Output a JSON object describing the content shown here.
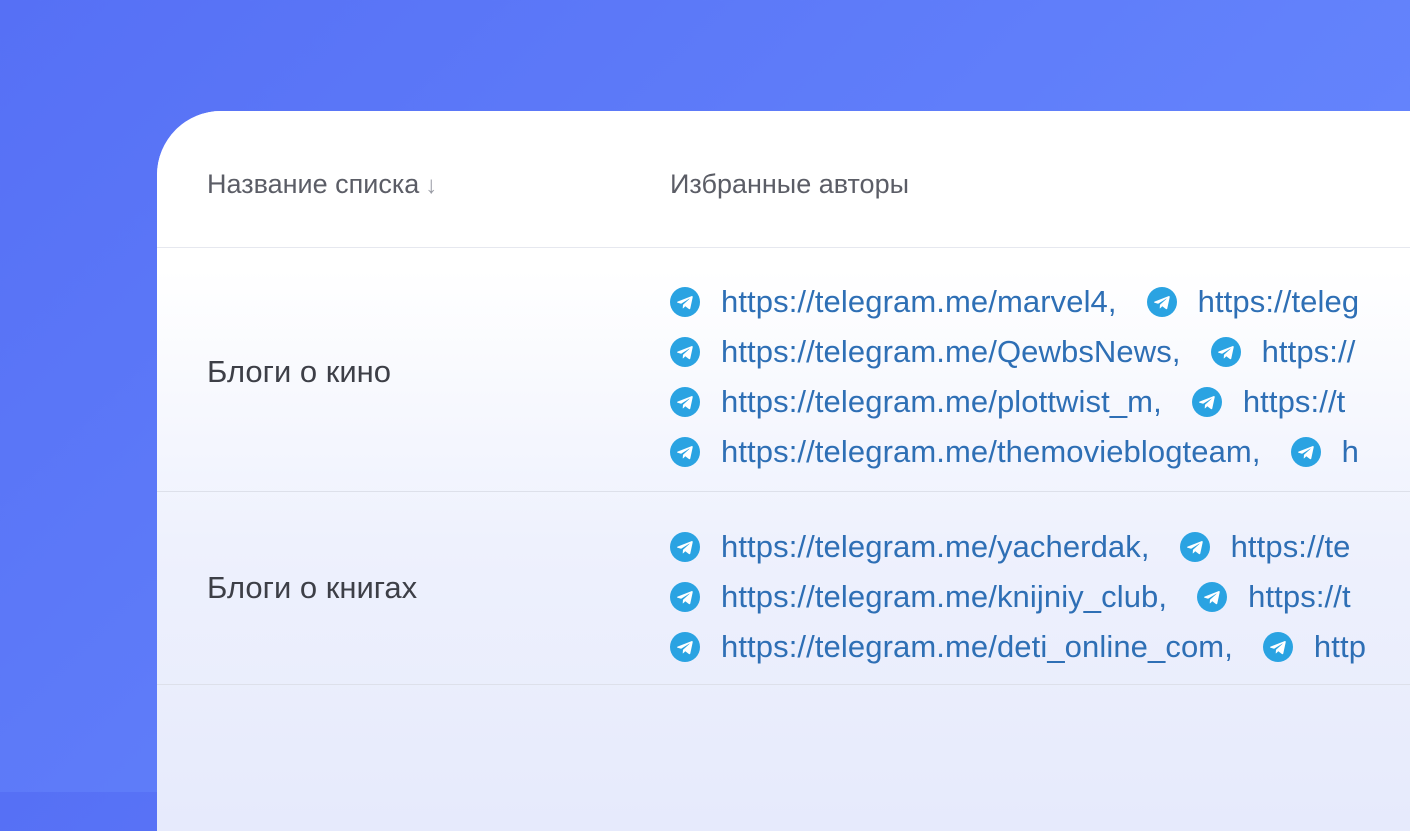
{
  "table": {
    "columns": [
      {
        "label": "Название списка",
        "sort_icon": "↓"
      },
      {
        "label": "Избранные авторы"
      }
    ],
    "rows": [
      {
        "name": "Блоги о кино",
        "links": [
          [
            "https://telegram.me/marvel4,",
            "https://teleg"
          ],
          [
            "https://telegram.me/QewbsNews,",
            "https://"
          ],
          [
            "https://telegram.me/plottwist_m,",
            "https://t"
          ],
          [
            "https://telegram.me/themovieblogteam,",
            "h"
          ]
        ]
      },
      {
        "name": "Блоги о книгах",
        "links": [
          [
            "https://telegram.me/yacherdak,",
            "https://te"
          ],
          [
            "https://telegram.me/knijniy_club,",
            "https://t"
          ],
          [
            "https://telegram.me/deti_online_com,",
            "http"
          ]
        ]
      }
    ]
  },
  "icons": {
    "link_icon": "telegram-icon"
  },
  "colors": {
    "link": "#2e6fb5",
    "telegram": "#2aa3e2",
    "background": "#5b78f8"
  }
}
